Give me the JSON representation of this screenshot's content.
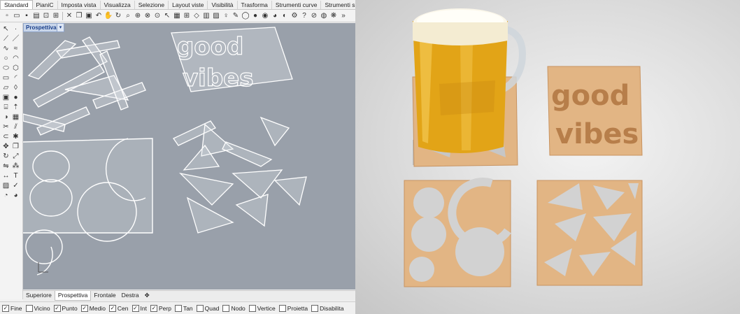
{
  "ribbon_tabs": [
    "Standard",
    "PianiC",
    "Imposta vista",
    "Visualizza",
    "Selezione",
    "Layout viste",
    "Visibilità",
    "Trasforma",
    "Strumenti curve",
    "Strumenti sup"
  ],
  "active_tab": "Standard",
  "viewport_label": "Prospettiva",
  "viewport_menu_icon": "chevron-down-icon",
  "view_tabs": [
    "Superiore",
    "Prospettiva",
    "Frontale",
    "Destra"
  ],
  "active_view_tab": "Prospettiva",
  "add_view_icon": "plus-icon",
  "osnaps": [
    {
      "label": "Fine",
      "checked": true
    },
    {
      "label": "Vicino",
      "checked": false
    },
    {
      "label": "Punto",
      "checked": true
    },
    {
      "label": "Medio",
      "checked": true
    },
    {
      "label": "Cen",
      "checked": true
    },
    {
      "label": "Int",
      "checked": true
    },
    {
      "label": "Perp",
      "checked": true
    },
    {
      "label": "Tan",
      "checked": false
    },
    {
      "label": "Quad",
      "checked": false
    },
    {
      "label": "Nodo",
      "checked": false
    },
    {
      "label": "Vertice",
      "checked": false
    },
    {
      "label": "Proietta",
      "checked": false
    },
    {
      "label": "Disabilita",
      "checked": false
    }
  ],
  "coaster_text": {
    "word1": "good",
    "word2": "vibes"
  },
  "colors": {
    "viewport_bg": "#99a0aa",
    "wood": "#e2b584",
    "wood_dark": "#c89360",
    "beer": "#e2a417",
    "foam": "#fbf7ea"
  }
}
